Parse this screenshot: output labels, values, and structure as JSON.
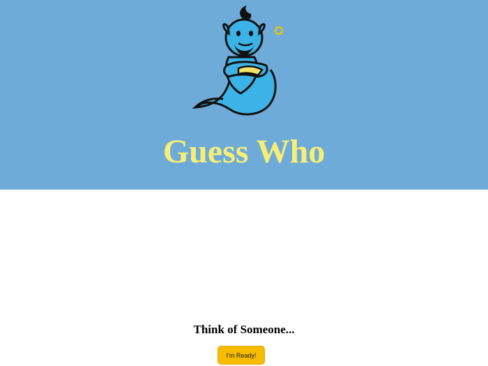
{
  "app": {
    "title": "Guess Who",
    "logo_icon": "genie-mascot-icon"
  },
  "colors": {
    "hero_background": "#6fabd9",
    "title_color": "#f7ee76",
    "button_background": "#f7bb00",
    "genie_body": "#3cb3e6"
  },
  "main": {
    "prompt": "Think of Someone...",
    "ready_button_label": "I'm Ready!"
  }
}
